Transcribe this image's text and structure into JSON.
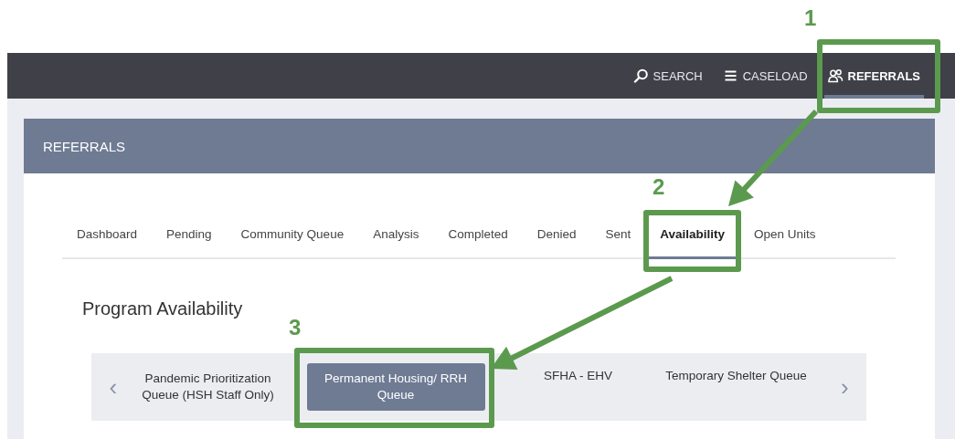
{
  "nav": [
    {
      "label": "SEARCH",
      "selected": false
    },
    {
      "label": "CASELOAD",
      "selected": false
    },
    {
      "label": "REFERRALS",
      "selected": true
    }
  ],
  "panel": {
    "title": "REFERRALS"
  },
  "tabs": [
    {
      "label": "Dashboard",
      "selected": false
    },
    {
      "label": "Pending",
      "selected": false
    },
    {
      "label": "Community Queue",
      "selected": false
    },
    {
      "label": "Analysis",
      "selected": false
    },
    {
      "label": "Completed",
      "selected": false
    },
    {
      "label": "Denied",
      "selected": false
    },
    {
      "label": "Sent",
      "selected": false
    },
    {
      "label": "Availability",
      "selected": true
    },
    {
      "label": "Open Units",
      "selected": false
    }
  ],
  "section_title": "Program Availability",
  "carousel": {
    "previous": "‹",
    "next": "›"
  },
  "programs": [
    {
      "label": "Pandemic Prioritization Queue (HSH Staff Only)",
      "selected": false
    },
    {
      "label": "Permanent Housing/ RRH Queue",
      "selected": true
    },
    {
      "label": "SFHA - EHV",
      "selected": false
    },
    {
      "label": "Temporary Shelter Queue",
      "selected": false
    }
  ],
  "annotations": [
    {
      "number": "1"
    },
    {
      "number": "2"
    },
    {
      "number": "3"
    }
  ]
}
